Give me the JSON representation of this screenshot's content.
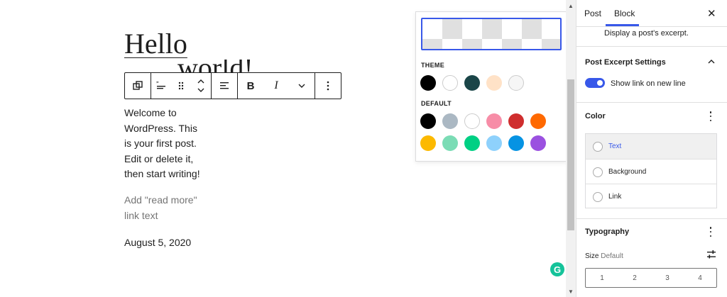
{
  "editor": {
    "post_title": "Hello",
    "post_title_overflow": "world!",
    "excerpt": "Welcome to WordPress. This is your first post. Edit or delete it, then start writing!",
    "read_more_placeholder": "Add \"read more\" link text",
    "post_date": "August 5, 2020"
  },
  "toolbar": {
    "bold": "B",
    "italic": "I"
  },
  "color_popover": {
    "theme_label": "THEME",
    "default_label": "DEFAULT",
    "theme_colors": [
      "#000000",
      "#ffffff",
      "#1a4548",
      "#ffe2c7",
      "#f6f6f6"
    ],
    "default_colors": [
      "#000000",
      "#abb8c3",
      "#ffffff",
      "#f78da7",
      "#cf2e2e",
      "#ff6900",
      "#fcb900",
      "#7bdcb5",
      "#00d084",
      "#8ed1fc",
      "#0693e3",
      "#9b51e0"
    ]
  },
  "sidebar": {
    "tabs": [
      "Post",
      "Block"
    ],
    "active_tab": "Block",
    "close": "✕",
    "block_description": "Display a post's excerpt.",
    "excerpt_settings_title": "Post Excerpt Settings",
    "toggle_label": "Show link on new line",
    "toggle_on": true,
    "color_title": "Color",
    "color_items": [
      "Text",
      "Background",
      "Link"
    ],
    "typography_title": "Typography",
    "size_label": "Size",
    "size_value": "Default",
    "size_options": [
      "1",
      "2",
      "3",
      "4"
    ]
  },
  "grammarly_glyph": "G",
  "accent_color": "#3858e9"
}
